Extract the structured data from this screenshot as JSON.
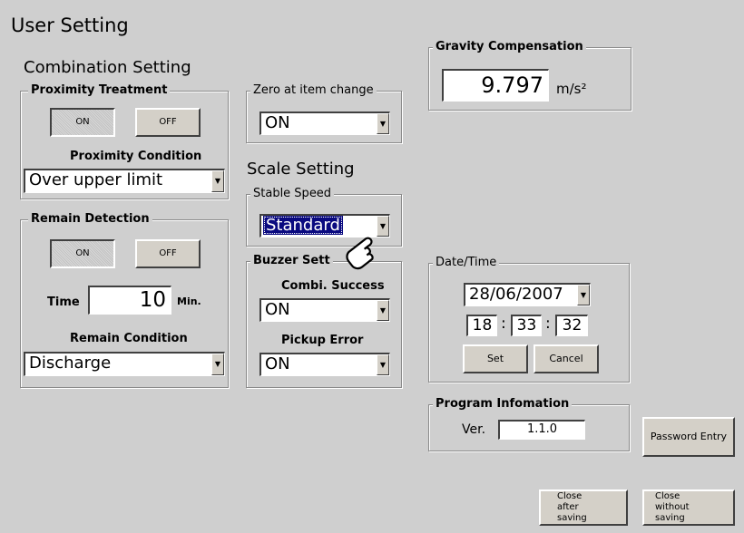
{
  "window": {
    "title": "User Setting"
  },
  "combination": {
    "heading": "Combination Setting",
    "proximity": {
      "title": "Proximity Treatment",
      "on_label": "ON",
      "off_label": "OFF",
      "condition_label": "Proximity Condition",
      "condition_value": "Over upper limit"
    },
    "remain": {
      "title": "Remain Detection",
      "on_label": "ON",
      "off_label": "OFF",
      "time_label": "Time",
      "time_value": "10",
      "time_unit": "Min.",
      "condition_label": "Remain Condition",
      "condition_value": "Discharge"
    }
  },
  "zero": {
    "title": "Zero at item change",
    "value": "ON"
  },
  "scale": {
    "heading": "Scale Setting",
    "stable_speed": {
      "title": "Stable Speed",
      "value": "Standard"
    }
  },
  "buzzer": {
    "title": "Buzzer Sett",
    "combi_label": "Combi. Success",
    "combi_value": "ON",
    "pickup_label": "Pickup Error",
    "pickup_value": "ON"
  },
  "gravity": {
    "title": "Gravity Compensation",
    "value": "9.797",
    "unit": "m/s²"
  },
  "datetime": {
    "title": "Date/Time",
    "date": "28/06/2007",
    "hour": "18",
    "minute": "33",
    "second": "32",
    "sep": ":",
    "set_label": "Set",
    "cancel_label": "Cancel"
  },
  "program": {
    "title": "Program Infomation",
    "ver_label": "Ver.",
    "ver_value": "1.1.0"
  },
  "buttons": {
    "password_entry": "Password Entry",
    "close_after_saving": "Close after saving",
    "close_without_saving": "Close without saving"
  },
  "icons": {
    "pointer": "pointing-hand-icon",
    "dropdown": "chevron-down-icon"
  }
}
